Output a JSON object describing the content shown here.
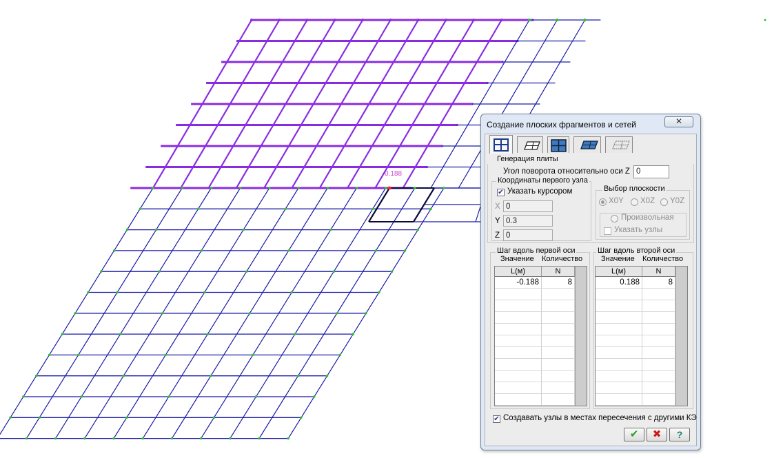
{
  "canvas": {
    "node_label": "0.188"
  },
  "dialog": {
    "title": "Создание плоских фрагментов и сетей",
    "close_glyph": "✕",
    "tabs": [
      {
        "name": "rect-grid-tab",
        "active": true
      },
      {
        "name": "skew-grid-tab",
        "active": false
      },
      {
        "name": "plate-tab",
        "active": false
      },
      {
        "name": "skew-plate-tab",
        "active": false
      },
      {
        "name": "hatched-plate-tab",
        "active": false
      }
    ],
    "generation_label": "Генерация плиты",
    "rotation_label": "Угол поворота относительно оси Z",
    "rotation_value": "0",
    "first_node_label": "Координаты первого узла",
    "cursor_checkbox_label": "Указать курсором",
    "cursor_checked": true,
    "x_label": "X",
    "x_value": "0",
    "y_label": "Y",
    "y_value": "0.3",
    "z_label": "Z",
    "z_value": "0",
    "plane_group_label": "Выбор плоскости",
    "plane_xoy": "X0Y",
    "plane_xoz": "X0Z",
    "plane_yoz": "Y0Z",
    "plane_arbitrary": "Произвольная",
    "specify_nodes_label": "Указать узлы",
    "axis1_group_label": "Шаг вдоль первой оси",
    "axis2_group_label": "Шаг вдоль второй оси",
    "value_label": "Значение",
    "count_label": "Количество",
    "col_l": "L(м)",
    "col_n": "N",
    "axis1_rows": [
      {
        "l": "-0.188",
        "n": "8"
      }
    ],
    "axis2_rows": [
      {
        "l": "0.188",
        "n": "8"
      }
    ],
    "intersections_label": "Создавать узлы в местах пересечения с другими КЭ",
    "intersections_checked": true,
    "ok_glyph": "✔",
    "cancel_glyph": "✖",
    "help_glyph": "?"
  },
  "colors": {
    "grid_blue": "#1a1aa8",
    "grid_purple": "#8a2be2",
    "node_green": "#22c922",
    "node_selected": "#ff2020",
    "label_magenta": "#cc44cc",
    "ok_green": "#2f9a2f",
    "cancel_red": "#d01818",
    "help_teal": "#1d7a6e"
  }
}
